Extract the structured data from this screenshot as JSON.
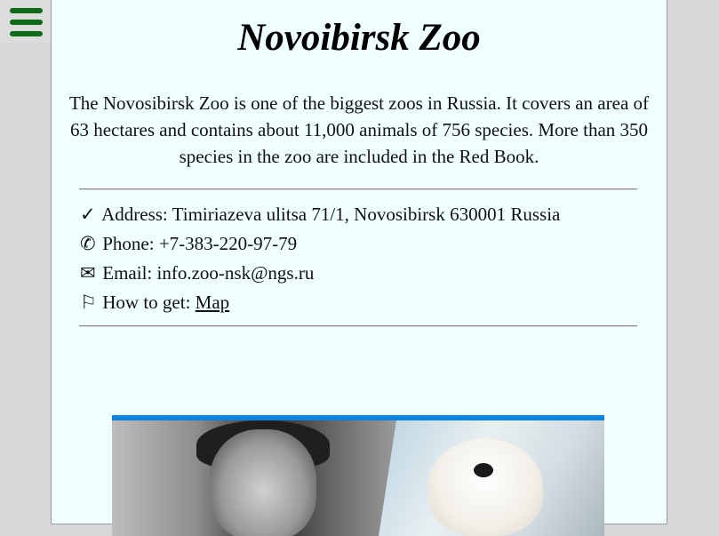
{
  "menu": {
    "icon": "hamburger-menu-icon",
    "color": "#0d6b1a"
  },
  "header": {
    "title": "Novoibirsk Zoo"
  },
  "intro": {
    "text": "The Novosibirsk Zoo is one of the biggest zoos in Russia. It covers an area of 63 hectares and contains about 11,000 animals of 756 species. More than 350 species in the zoo are included in the Red Book."
  },
  "info": {
    "address": {
      "icon": "✓",
      "icon_name": "check-icon",
      "label": "Address:",
      "value": "Timiriazeva ulitsa 71/1, Novosibirsk 630001 Russia"
    },
    "phone": {
      "icon": "✆",
      "icon_name": "phone-icon",
      "label": "Phone:",
      "value": "+7-383-220-97-79"
    },
    "email": {
      "icon": "✉",
      "icon_name": "envelope-icon",
      "label": "Email:",
      "value": "info.zoo-nsk@ngs.ru"
    },
    "directions": {
      "icon": "⚐",
      "icon_name": "flag-icon",
      "label": "How to get:",
      "link": "Map"
    }
  },
  "colors": {
    "panel_bg": "#f0ffff",
    "page_bg": "#d8d8d8",
    "photo_border": "#0a84e0"
  }
}
